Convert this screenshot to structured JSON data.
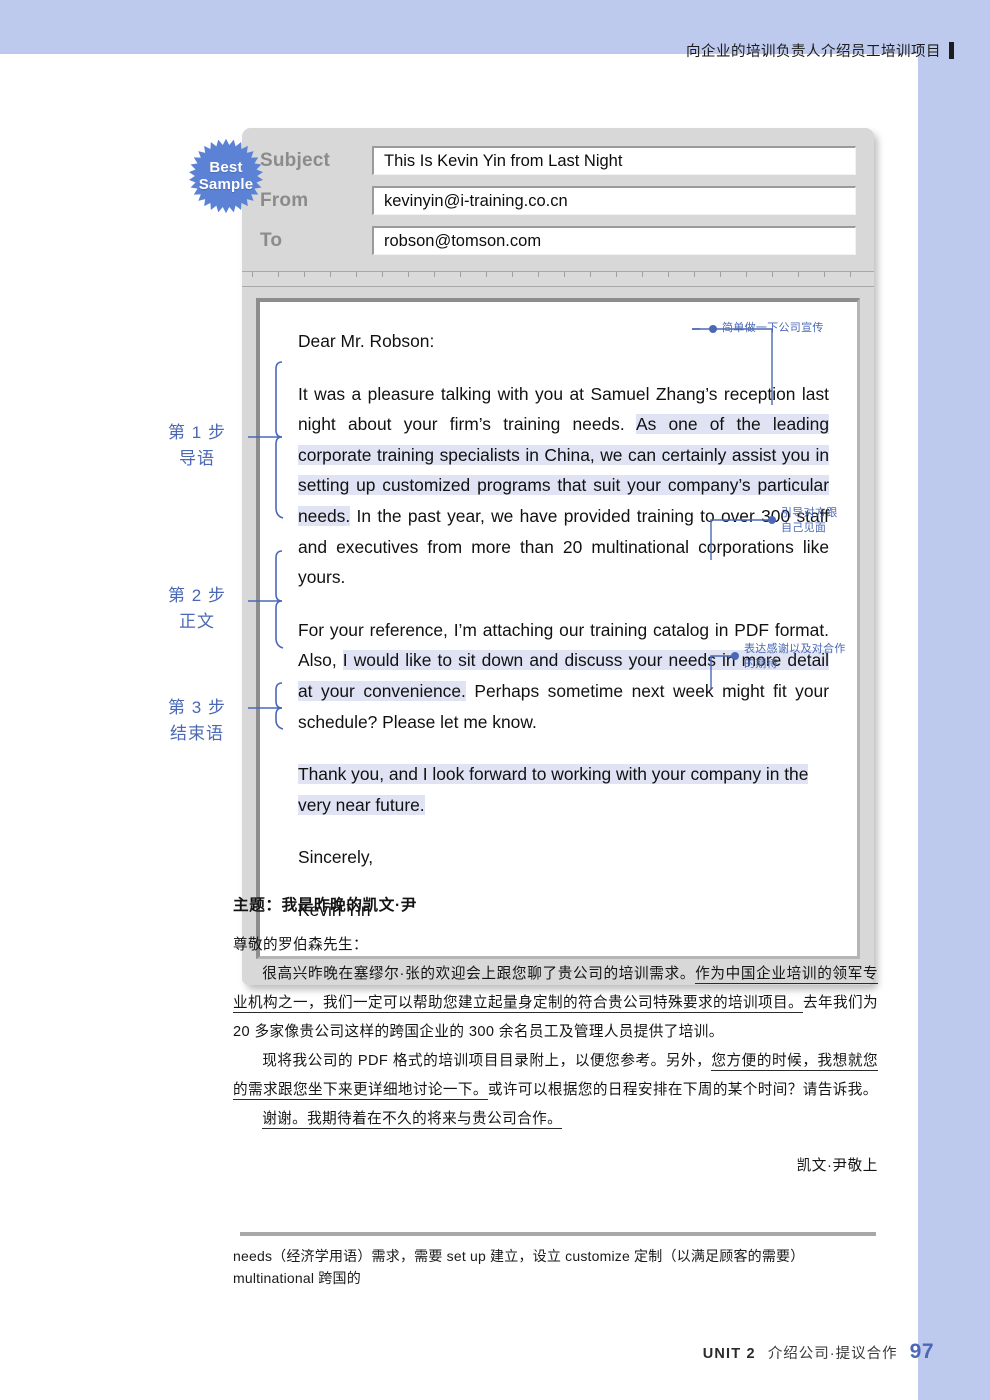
{
  "page": {
    "background_color": "#bdc9ed",
    "sheet_color": "#ffffff",
    "accent_color": "#4a68b5",
    "highlight_color": "#dfe3f3",
    "running_head": "向企业的培训负责人介绍员工培训项目"
  },
  "badge": {
    "line1": "Best",
    "line2": "Sample",
    "color": "#5c82d6"
  },
  "mail": {
    "fields": [
      {
        "label": "Subject",
        "value": "This Is Kevin Yin from Last Night"
      },
      {
        "label": "From",
        "value": "kevinyin@i-training.co.cn"
      },
      {
        "label": "To",
        "value": "robson@tomson.com"
      }
    ],
    "salutation": "Dear Mr. Robson:",
    "para1": {
      "before": "It was a pleasure talking with you at Samuel Zhang’s reception last night about your firm’s training needs. ",
      "highlight": "As one of the leading corporate training specialists in China, we can certainly assist you in setting up customized programs that suit your company’s particular needs.",
      "after": " In the past year, we have provided training to over 300 staff and executives from more than 20 multinational corporations like yours."
    },
    "para2": {
      "before": "For your reference, I’m attaching our training catalog in PDF format. Also, ",
      "highlight": "I would like to sit down and discuss your needs in more detail at your convenience.",
      "after": " Perhaps sometime next week might fit your schedule? Please let me know."
    },
    "para3": {
      "highlight": "Thank you, and I look forward to working with your company in the very near future."
    },
    "closing": "Sincerely,",
    "signature": "Kevin Yin"
  },
  "steps": [
    {
      "title": "第 1 步",
      "subtitle": "导语"
    },
    {
      "title": "第 2 步",
      "subtitle": "正文"
    },
    {
      "title": "第 3 步",
      "subtitle": "结束语"
    }
  ],
  "annotations": [
    {
      "text": "简单做一下公司宣传"
    },
    {
      "line1": "引导对方跟",
      "line2": "自己见面"
    },
    {
      "line1": "表达感谢以及对合作",
      "line2": "的期待"
    }
  ],
  "translation": {
    "title": "主题：我是昨晚的凯文·尹",
    "salutation": "尊敬的罗伯森先生：",
    "para1_a": "很高兴昨晚在塞缪尔·张的欢迎会上跟您聊了贵公司的培训需求。",
    "para1_u": "作为中国企业培训的领军专业机构之一，我们一定可以帮助您建立起量身定制的符合贵公司特殊要求的培训项目。",
    "para1_b": "去年我们为 20 多家像贵公司这样的跨国企业的 300 余名员工及管理人员提供了培训。",
    "para2_a": "现将我公司的 PDF 格式的培训项目目录附上，以便您参考。另外，",
    "para2_u": "您方便的时候，我想就您的需求跟您坐下来更详细地讨论一下。",
    "para2_b": "或许可以根据您的日程安排在下周的某个时间？请告诉我。",
    "para3_u": "谢谢。我期待着在不久的将来与贵公司合作。",
    "signature": "凯文·尹敬上"
  },
  "glossary": {
    "line1": "needs（经济学用语）需求，需要  set up 建立，设立  customize 定制（以满足顾客的需要）",
    "line2": "multinational 跨国的"
  },
  "footer": {
    "unit": "UNIT 2",
    "topic": "介绍公司·提议合作",
    "page_number": "97"
  }
}
